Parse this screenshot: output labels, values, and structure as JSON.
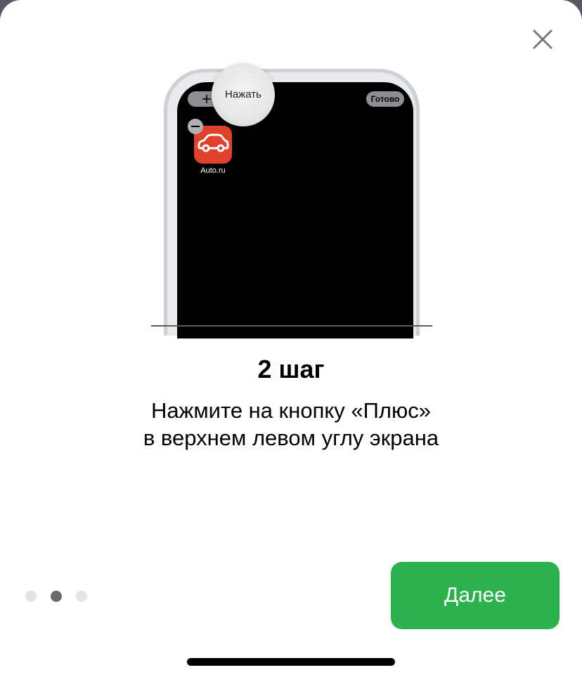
{
  "illustration": {
    "press_hint": "Нажать",
    "done_label": "Готово",
    "app_name": "Auto.ru",
    "app_icon": "car-icon",
    "app_icon_color": "#e0412c"
  },
  "step": {
    "title": "2 шаг",
    "description_line1": "Нажмите на кнопку «Плюс»",
    "description_line2": "в верхнем левом углу экрана"
  },
  "pagination": {
    "total": 3,
    "current": 2
  },
  "actions": {
    "next_label": "Далее"
  },
  "colors": {
    "primary": "#2bb24c",
    "dot_active": "#6b6b6b",
    "dot_inactive": "#e3e3e3"
  }
}
